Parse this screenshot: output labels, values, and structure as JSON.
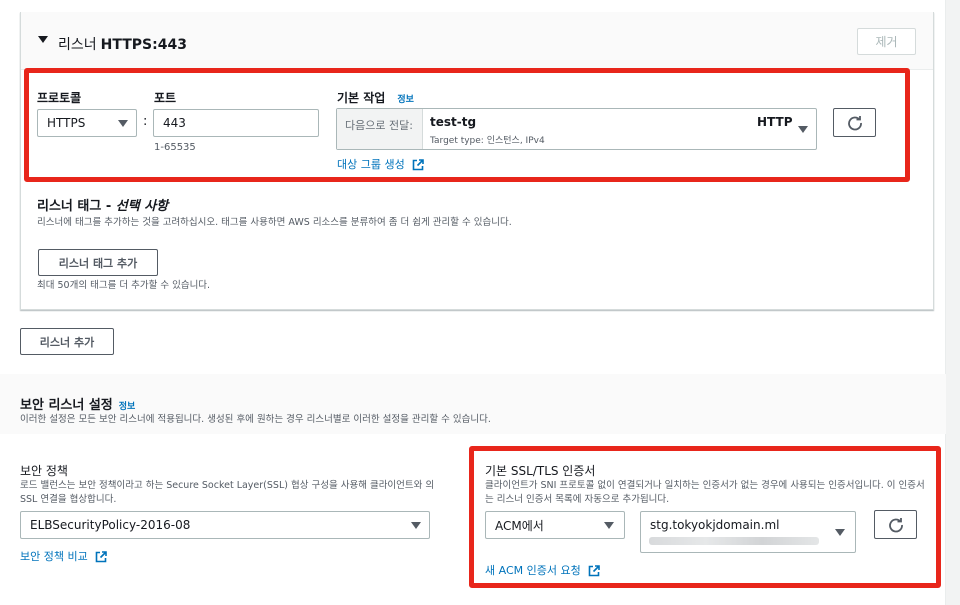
{
  "listener": {
    "title_prefix": "리스너",
    "title_proto": "HTTPS:443",
    "remove_label": "제거",
    "protocol_label": "프로토콜",
    "protocol_value": "HTTPS",
    "port_label": "포트",
    "port_value": "443",
    "port_hint": "1-65535",
    "default_action_label": "기본 작업",
    "info_label": "정보",
    "forward_prefix": "다음으로 전달:",
    "target_group_name": "test-tg",
    "target_group_sub": "Target type: 인스턴스, IPv4",
    "target_group_protocol": "HTTP",
    "create_tg_link": "대상 그룹 생성",
    "tags_title": "리스너 태그 - ",
    "tags_optional": "선택 사항",
    "tags_desc": "리스너에 태그를 추가하는 것을 고려하십시오. 태그를 사용하면 AWS 리소스를 분류하여 좀 더 쉽게 관리할 수 있습니다.",
    "add_tag_button": "리스너 태그 추가",
    "tags_hint": "최대 50개의 태그를 더 추가할 수 있습니다."
  },
  "add_listener_button": "리스너 추가",
  "security": {
    "title": "보안 리스너 설정",
    "info_label": "정보",
    "desc": "이러한 설정은 모든 보안 리스너에 적용됩니다. 생성된 후에 원하는 경우 리스너별로 이러한 설정을 관리할 수 있습니다.",
    "policy_label": "보안 정책",
    "policy_desc": "로드 밸런스는 보안 정책이라고 하는 Secure Socket Layer(SSL) 협상 구성을 사용해 클라이언트와 의 SSL 연결을 협상합니다.",
    "policy_value": "ELBSecurityPolicy-2016-08",
    "policy_compare_link": "보안 정책 비교",
    "cert_label": "기본 SSL/TLS 인증서",
    "cert_desc": "클라이언트가 SNI 프로토콜 없이 연결되거나 일치하는 인증서가 없는 경우에 사용되는 인증서입니다. 이 인증서는 리스너 인증서 목록에 자동으로 추가됩니다.",
    "cert_source": "ACM에서",
    "cert_value": "stg.tokyokjdomain.ml",
    "request_cert_link": "새 ACM 인증서 요청"
  },
  "colors": {
    "highlight": "#e8261b",
    "link": "#0073bb"
  }
}
